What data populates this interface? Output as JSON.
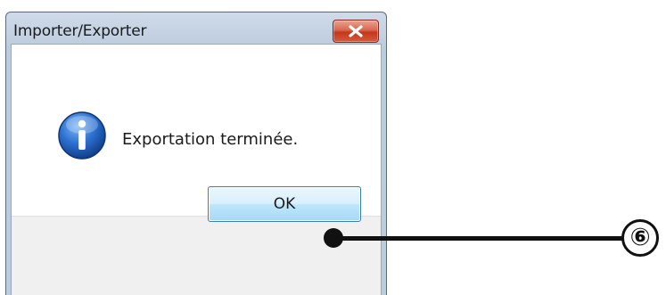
{
  "window": {
    "title": "Importer/Exporter",
    "close_icon": "close-icon"
  },
  "message": {
    "icon": "info-icon",
    "text": "Exportation terminée."
  },
  "buttons": {
    "ok_label": "OK"
  },
  "callout": {
    "number": "⑥"
  },
  "colors": {
    "close_button": "#c8432a",
    "ok_button_border": "#3c7fb1",
    "info_icon": "#1f5fb4",
    "footer_bg": "#f0f0f0"
  }
}
